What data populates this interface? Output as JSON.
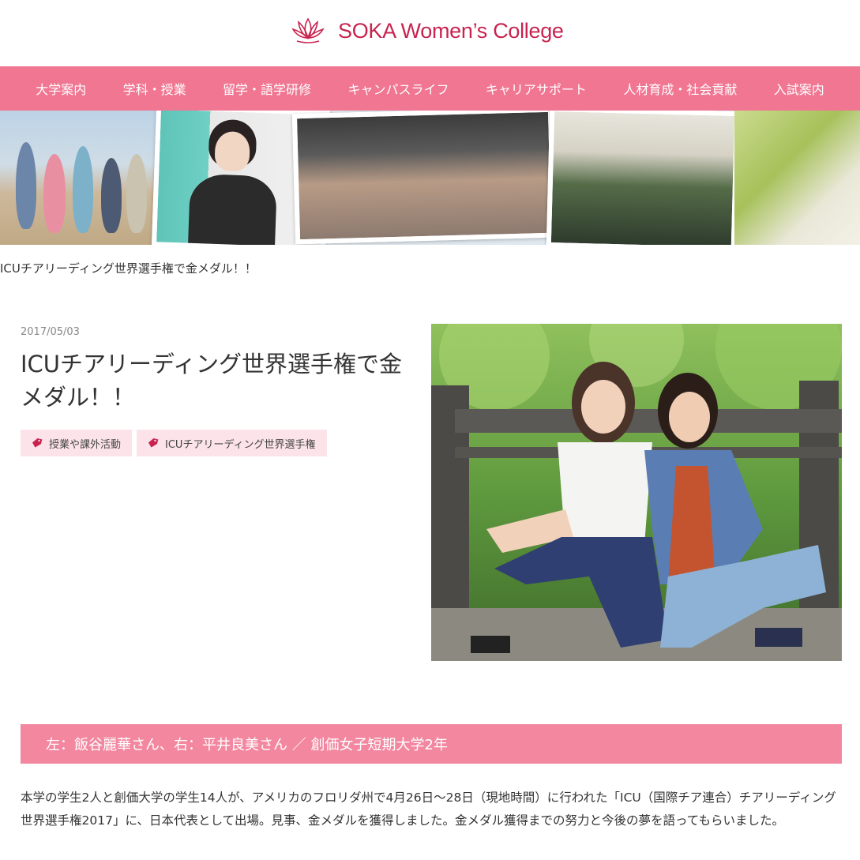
{
  "header": {
    "logo_text": "SOKA Women’s College",
    "logo_icon": "lotus-icon",
    "brand_color": "#c8234f"
  },
  "nav": {
    "color": "#f07692",
    "items": [
      {
        "label": "大学案内"
      },
      {
        "label": "学科・授業"
      },
      {
        "label": "留学・語学研修"
      },
      {
        "label": "キャンパスライフ"
      },
      {
        "label": "キャリアサポート"
      },
      {
        "label": "人材育成・社会貢献"
      },
      {
        "label": "入試案内"
      }
    ]
  },
  "breadcrumb": {
    "current": "ICUチアリーディング世界選手権で金メダル！！"
  },
  "article": {
    "date": "2017/05/03",
    "title": "ICUチアリーディング世界選手権で金メダル！！",
    "tags": [
      {
        "label": "授業や課外活動",
        "icon": "tag-icon"
      },
      {
        "label": "ICUチアリーディング世界選手権",
        "icon": "tag-icon"
      }
    ],
    "caption": "左：飯谷麗華さん、右：平井良美さん ／ 創価女子短期大学2年",
    "body": "本学の学生2人と創価大学の学生14人が、アメリカのフロリダ州で4月26日〜28日（現地時間）に行われた「ICU（国際チア連合）チアリーディング世界選手権2017」に、日本代表として出場。見事、金メダルを獲得しました。金メダル獲得までの努力と今後の夢を語ってもらいました。"
  }
}
